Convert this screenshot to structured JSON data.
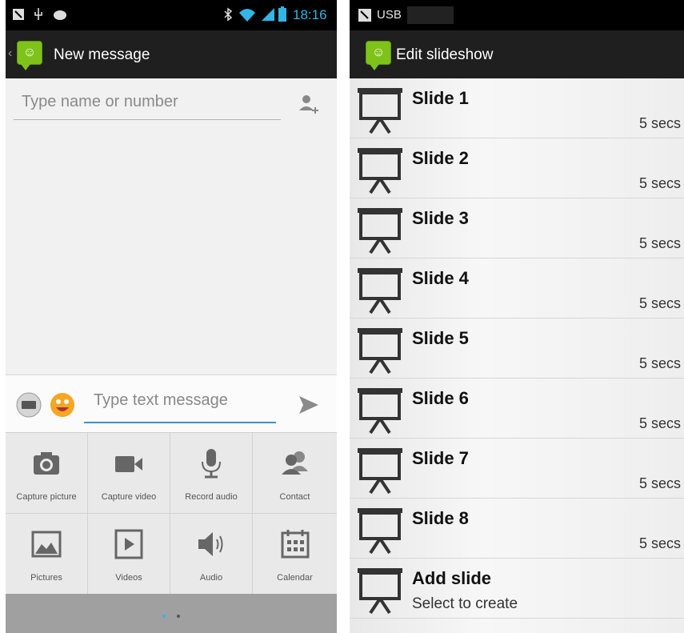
{
  "left": {
    "status_time": "18:16",
    "title": "New message",
    "to_placeholder": "Type name or number",
    "compose_placeholder": "Type text message",
    "attachments": [
      {
        "label": "Capture picture",
        "icon": "camera-icon"
      },
      {
        "label": "Capture video",
        "icon": "video-camera-icon"
      },
      {
        "label": "Record audio",
        "icon": "microphone-icon"
      },
      {
        "label": "Contact",
        "icon": "contact-icon"
      },
      {
        "label": "Pictures",
        "icon": "picture-icon"
      },
      {
        "label": "Videos",
        "icon": "video-play-icon"
      },
      {
        "label": "Audio",
        "icon": "speaker-icon"
      },
      {
        "label": "Calendar",
        "icon": "calendar-icon"
      }
    ]
  },
  "right": {
    "status_text": "USB",
    "title": "Edit slideshow",
    "slides": [
      {
        "title": "Slide 1",
        "duration": "5 secs"
      },
      {
        "title": "Slide 2",
        "duration": "5 secs"
      },
      {
        "title": "Slide 3",
        "duration": "5 secs"
      },
      {
        "title": "Slide 4",
        "duration": "5 secs"
      },
      {
        "title": "Slide 5",
        "duration": "5 secs"
      },
      {
        "title": "Slide 6",
        "duration": "5 secs"
      },
      {
        "title": "Slide 7",
        "duration": "5 secs"
      },
      {
        "title": "Slide 8",
        "duration": "5 secs"
      }
    ],
    "add_slide": {
      "title": "Add slide",
      "subtitle": "Select to create"
    }
  },
  "colors": {
    "accent_blue": "#3a93c8",
    "app_green": "#7fc21a",
    "wifi_blue": "#33b5e5"
  }
}
